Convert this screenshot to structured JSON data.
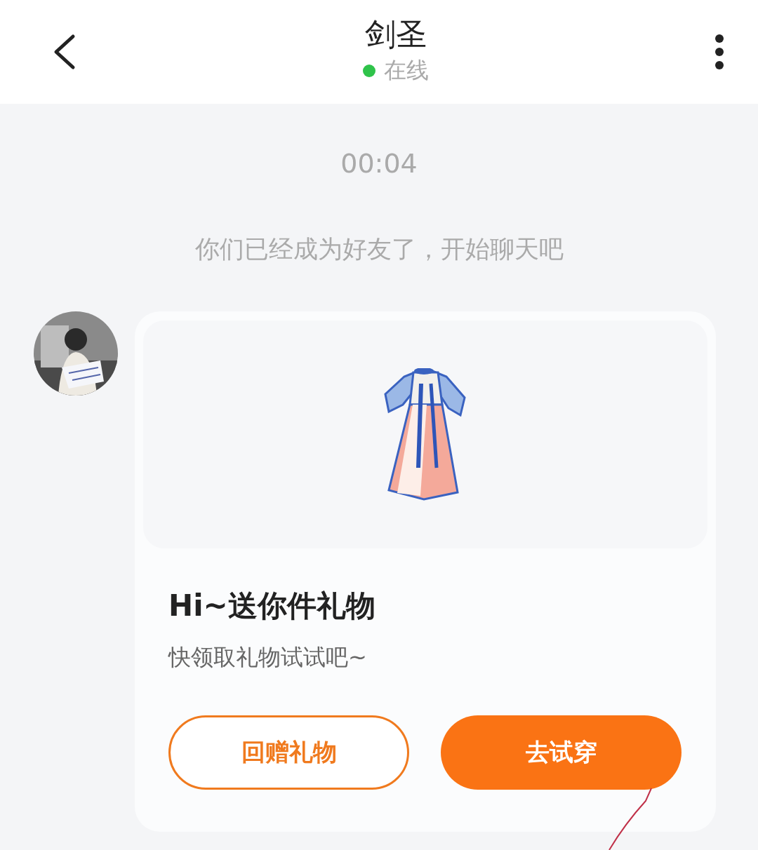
{
  "header": {
    "title": "剑圣",
    "status": {
      "label": "在线",
      "online": true
    }
  },
  "messages": [
    {
      "kind": "time",
      "text": "00:04"
    },
    {
      "kind": "system",
      "text": "你们已经成为好友了，开始聊天吧"
    },
    {
      "kind": "gift",
      "image": {
        "kind": "picture"
      },
      "title": "Hi~送你件礼物",
      "subtitle": "快领取礼物试试吧~",
      "buttons": [
        {
          "label": "回赠礼物",
          "primary": false
        },
        {
          "label": "去试穿",
          "primary": true
        }
      ]
    }
  ]
}
